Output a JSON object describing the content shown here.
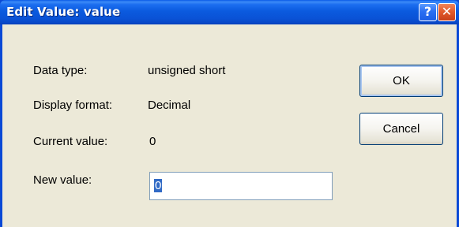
{
  "window": {
    "title": "Edit Value: value",
    "help_glyph": "?",
    "close_glyph": "✕"
  },
  "fields": {
    "data_type_label": "Data type:",
    "data_type_value": "unsigned short",
    "display_format_label": "Display format:",
    "display_format_value": "Decimal",
    "current_value_label": "Current value:",
    "current_value": "0",
    "new_value_label": "New value:",
    "new_value": "0"
  },
  "buttons": {
    "ok_label": "OK",
    "cancel_label": "Cancel"
  },
  "colors": {
    "titlebar": "#0a52d6",
    "client_bg": "#ece9d8",
    "selection": "#316ac5",
    "close_button": "#e35b2c"
  }
}
